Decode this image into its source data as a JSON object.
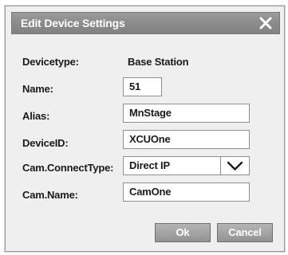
{
  "dialog": {
    "title": "Edit Device Settings",
    "close_icon": "close-icon"
  },
  "fields": {
    "devicetype": {
      "label": "Devicetype:",
      "value": "Base Station"
    },
    "name": {
      "label": "Name:",
      "value": "51"
    },
    "alias": {
      "label": "Alias:",
      "value": "MnStage"
    },
    "deviceid": {
      "label": "DeviceID:",
      "value": "XCUOne"
    },
    "cam_connect_type": {
      "label": "Cam.ConnectType:",
      "value": "Direct IP",
      "icon": "chevron-down-icon"
    },
    "cam_name": {
      "label": "Cam.Name:",
      "value": "CamOne"
    }
  },
  "buttons": {
    "ok": "Ok",
    "cancel": "Cancel"
  }
}
